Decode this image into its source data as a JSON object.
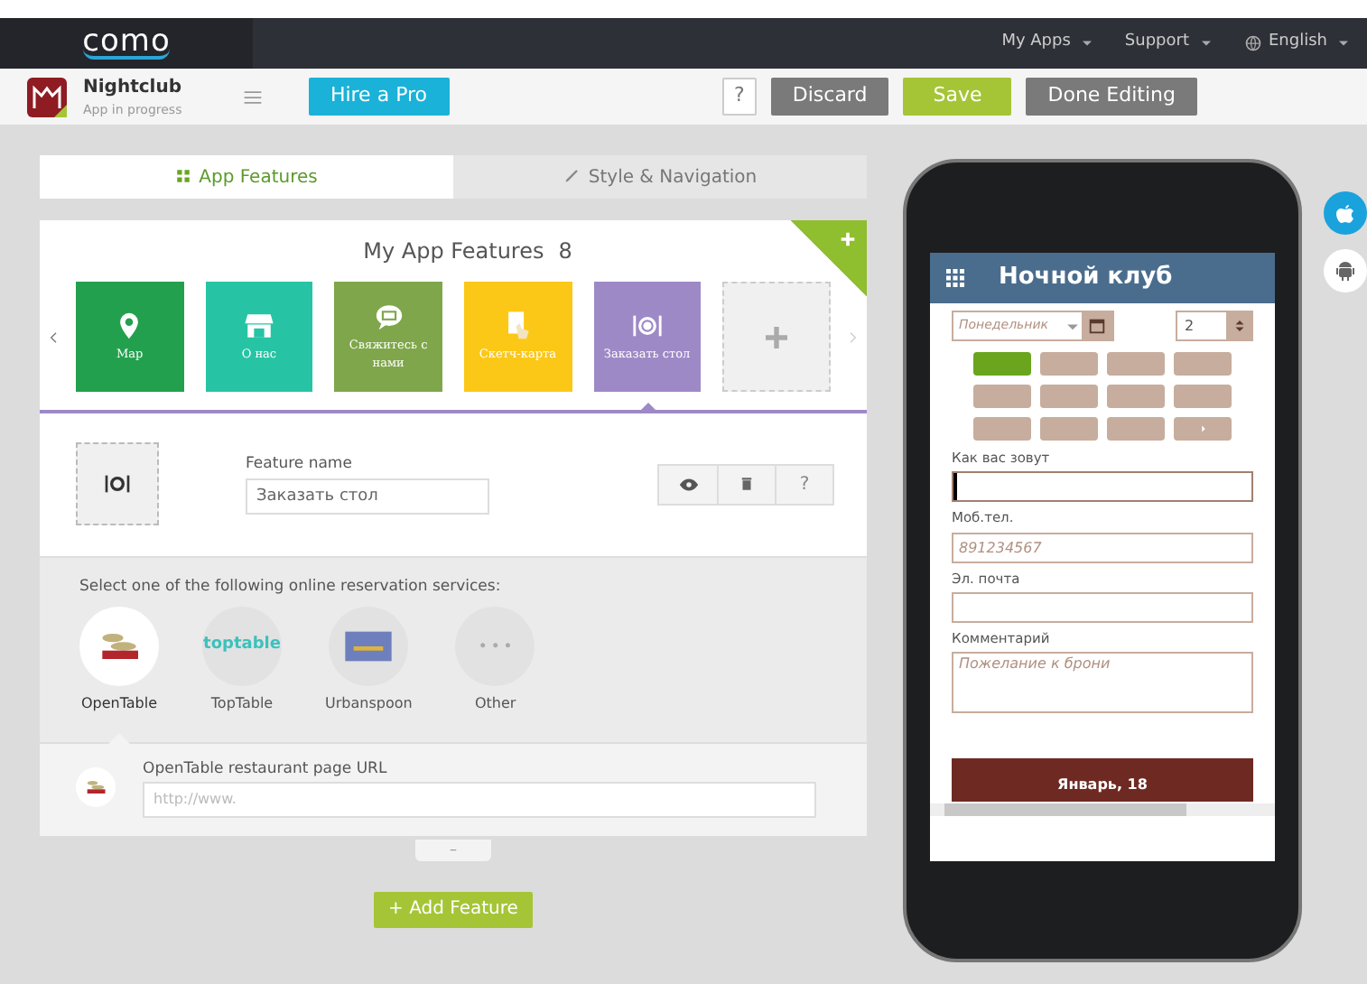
{
  "topbar": {
    "logo": "como",
    "menus": [
      {
        "label": "My Apps"
      },
      {
        "label": "Support"
      },
      {
        "label": "English",
        "kind": "language"
      }
    ]
  },
  "toolbar": {
    "app_name": "Nightclub",
    "app_status": "App in progress",
    "hire": "Hire a Pro",
    "help": "?",
    "buttons": [
      {
        "label": "Discard",
        "kind": "secondary"
      },
      {
        "label": "Save",
        "kind": "primary"
      },
      {
        "label": "Done Editing",
        "kind": "secondary"
      }
    ]
  },
  "tabs": [
    {
      "label": "App Features",
      "selected": true
    },
    {
      "label": "Style & Navigation",
      "selected": false
    }
  ],
  "features": {
    "title": "My App Features",
    "count": "8",
    "items": [
      {
        "label": "Map",
        "color": "#23a04d",
        "selected": false,
        "kind": "pin"
      },
      {
        "label": "О нас",
        "color": "#26c4a4",
        "selected": false,
        "kind": "store"
      },
      {
        "label": "Свяжитесь с нами",
        "color": "#7fa64a",
        "selected": false,
        "kind": "chat"
      },
      {
        "label": "Скетч-карта",
        "color": "#fcc817",
        "selected": false,
        "kind": "card"
      },
      {
        "label": "Заказать стол",
        "color": "#9e89c7",
        "selected": true,
        "kind": "dish"
      }
    ]
  },
  "editor": {
    "label": "Feature name",
    "value": "Заказать стол",
    "help": "?"
  },
  "reservation": {
    "prompt": "Select one of the following online reservation services:",
    "services": [
      {
        "label": "OpenTable",
        "selected": true,
        "kind": "opentable"
      },
      {
        "label": "TopTable",
        "selected": false,
        "kind": "toptable",
        "logo_text": "toptable"
      },
      {
        "label": "Urbanspoon",
        "selected": false,
        "kind": "urbanspoon"
      },
      {
        "label": "Other",
        "selected": false,
        "kind": "other",
        "logo_text": "• • •"
      }
    ]
  },
  "url": {
    "label": "OpenTable restaurant page URL",
    "value": "http://www."
  },
  "collapse": "–",
  "add_feature": "+ Add Feature",
  "phone": {
    "title": "Ночной клуб",
    "day": {
      "placeholder": "Понедельник"
    },
    "guests": "2",
    "time_slots": [
      {
        "selected": true
      },
      {
        "selected": false
      },
      {
        "selected": false
      },
      {
        "selected": false
      },
      {
        "selected": false
      },
      {
        "selected": false
      },
      {
        "selected": false
      },
      {
        "selected": false
      },
      {
        "selected": false
      },
      {
        "selected": false
      },
      {
        "selected": false
      },
      {
        "selected": false,
        "kind": "more"
      }
    ],
    "fields": [
      {
        "label": "Как вас зовут",
        "kind": "input",
        "focused": true
      },
      {
        "label": "Моб.тел.",
        "kind": "input",
        "placeholder": "891234567"
      },
      {
        "label": "Эл. почта",
        "kind": "input"
      },
      {
        "label": "Комментарий",
        "kind": "textarea",
        "placeholder": "Пожелание к брони"
      }
    ],
    "banner": "Январь, 18"
  },
  "platforms": [
    {
      "kind": "ios",
      "selected": true
    },
    {
      "kind": "android",
      "selected": false
    }
  ]
}
